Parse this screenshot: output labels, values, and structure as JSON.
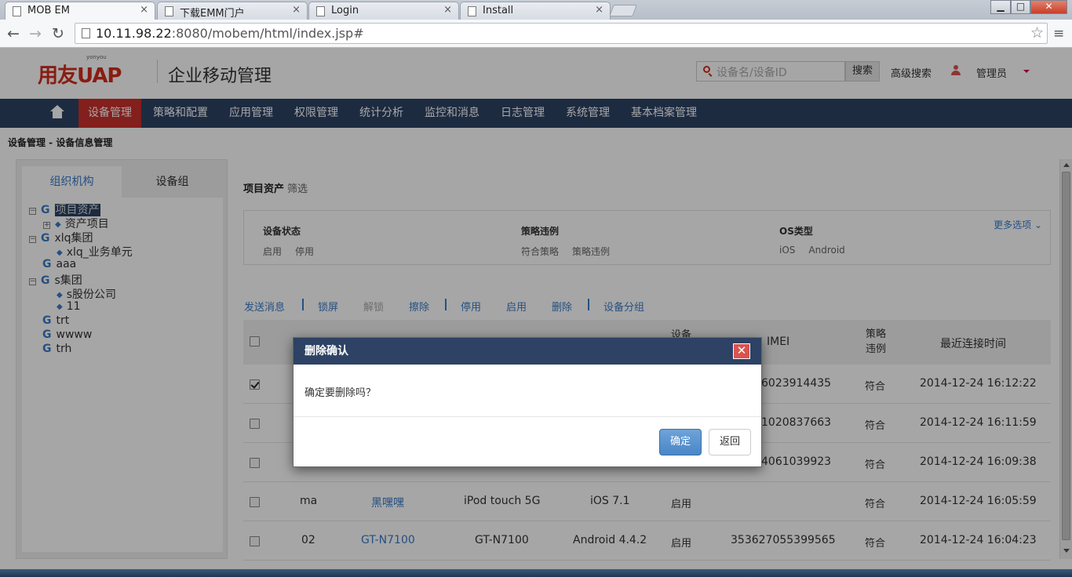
{
  "browser": {
    "tabs": [
      {
        "title": "MOB EM",
        "active": true
      },
      {
        "title": "下载EMM门户",
        "active": false
      },
      {
        "title": "Login",
        "active": false
      },
      {
        "title": "Install",
        "active": false
      }
    ],
    "tab_close": "×",
    "url_host": "10.11.98.22",
    "url_path": ":8080/mobem/html/index.jsp#",
    "icons": {
      "back": "back-icon",
      "forward": "forward-icon",
      "reload": "reload-icon",
      "star": "bookmark-star-icon",
      "menu": "menu-icon"
    },
    "glyphs": {
      "back": "←",
      "forward": "→",
      "reload": "↻",
      "star": "☆",
      "menu": "≡",
      "minimize": "▁",
      "maximize": "□",
      "close": "✕"
    }
  },
  "header": {
    "logo_text": "用友UAP",
    "logo_sub": "yonyou",
    "product_title": "企业移动管理",
    "search_placeholder": "设备名/设备ID",
    "search_button": "搜索",
    "advanced_search": "高级搜索",
    "user": "管理员"
  },
  "nav": {
    "items": [
      "设备管理",
      "策略和配置",
      "应用管理",
      "权限管理",
      "统计分析",
      "监控和消息",
      "日志管理",
      "系统管理",
      "基本档案管理"
    ],
    "active_index": 0,
    "active_color": "#c9302c",
    "bar_color": "#2d4264"
  },
  "breadcrumb": "设备管理 -  设备信息管理",
  "left": {
    "tabs": [
      "组织机构",
      "设备组"
    ],
    "tree": [
      {
        "label": "项目资产",
        "type": "group",
        "expander": "⊟",
        "selected": true
      },
      {
        "label": "资产项目",
        "type": "item",
        "expander": "⊞"
      },
      {
        "label": "xlq集团",
        "type": "group",
        "expander": "⊟"
      },
      {
        "label": "xlq_业务单元",
        "type": "item"
      },
      {
        "label": "aaa",
        "type": "group"
      },
      {
        "label": "s集团",
        "type": "group",
        "expander": "⊟"
      },
      {
        "label": "s股份公司",
        "type": "item"
      },
      {
        "label": "11",
        "type": "item"
      },
      {
        "label": "trt",
        "type": "group"
      },
      {
        "label": "wwww",
        "type": "group"
      },
      {
        "label": "trh",
        "type": "group"
      }
    ],
    "group_glyph": "G",
    "item_glyph": "◆"
  },
  "filter": {
    "title": "项目资产",
    "subtitle": "筛选",
    "more": "更多选项",
    "groups": [
      {
        "heading": "设备状态",
        "options": [
          "启用",
          "停用"
        ]
      },
      {
        "heading": "策略违例",
        "options": [
          "符合策略",
          "策略违例"
        ]
      },
      {
        "heading": "OS类型",
        "options": [
          "iOS",
          "Android"
        ]
      }
    ]
  },
  "actions": [
    {
      "label": "发送消息",
      "enabled": true
    },
    {
      "label": "锁屏",
      "enabled": true
    },
    {
      "label": "解锁",
      "enabled": false
    },
    {
      "label": "擦除",
      "enabled": true
    },
    {
      "label": "停用",
      "enabled": true
    },
    {
      "label": "启用",
      "enabled": true
    },
    {
      "label": "删除",
      "enabled": true
    },
    {
      "label": "设备分组",
      "enabled": true
    }
  ],
  "table": {
    "headers": {
      "status_partial": "设备",
      "imei": "IMEI",
      "policy": "策略\n违例",
      "last_conn": "最近连接时间"
    },
    "rows": [
      {
        "checked": true,
        "c1": "",
        "c2": "",
        "c3": "",
        "c4": "",
        "status": "",
        "imei": "6023914435",
        "policy": "符合",
        "time": "2014-12-24 16:12:22"
      },
      {
        "checked": false,
        "c1": "",
        "c2": "",
        "c3": "",
        "c4": "",
        "status": "",
        "imei": "1020837663",
        "policy": "符合",
        "time": "2014-12-24 16:11:59"
      },
      {
        "checked": false,
        "c1": "",
        "c2": "",
        "c3": "",
        "c4": "",
        "status": "",
        "imei": "4061039923",
        "policy": "符合",
        "time": "2014-12-24 16:09:38"
      },
      {
        "checked": false,
        "c1": "ma",
        "c2": "黑嘿嘿",
        "c3": "iPod touch 5G",
        "c4": "iOS 7.1",
        "status": "启用",
        "imei": "",
        "policy": "符合",
        "time": "2014-12-24 16:05:59"
      },
      {
        "checked": false,
        "c1": "02",
        "c2": "GT-N7100",
        "c3": "GT-N7100",
        "c4": "Android 4.4.2",
        "status": "启用",
        "imei": "353627055399565",
        "policy": "符合",
        "time": "2014-12-24 16:04:23"
      }
    ]
  },
  "modal": {
    "title": "删除确认",
    "message": "确定要删除吗？",
    "confirm": "确定",
    "cancel": "返回",
    "close_glyph": "✕"
  }
}
